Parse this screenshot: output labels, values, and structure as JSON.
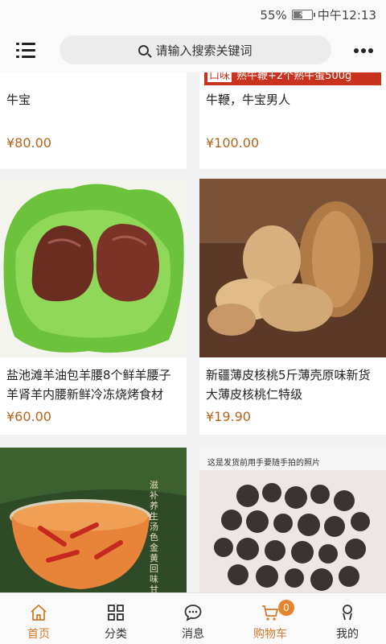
{
  "status_bar": {
    "battery": "55%",
    "time": "中午12:13",
    "battery_level": 0.55
  },
  "header": {
    "search_placeholder": "请输入搜索关键词"
  },
  "products": [
    {
      "title": "牛宝",
      "price": "¥80.00",
      "image": "partial-image"
    },
    {
      "title": "牛鞭，牛宝男人",
      "price": "¥100.00",
      "image": "banner-image",
      "banner_text": "口味 熟牛鞭+2个熟牛蛋500g",
      "banner_tag": "口味",
      "banner_body": "熟牛鞭+2个熟牛蛋500g"
    },
    {
      "title": "盐池滩羊油包羊腰8个鲜羊腰子羊肾羊内腰新鲜冷冻烧烤食材",
      "price": "¥60.00",
      "image": "lamb-kidney-photo"
    },
    {
      "title": "新疆薄皮核桃5斤薄壳原味新货大薄皮核桃仁特级",
      "price": "¥19.90",
      "image": "walnut-photo"
    },
    {
      "title": "",
      "price": "",
      "image": "goji-soup-photo",
      "image_text": "滋补养生 汤色金黄 回味甘甜"
    },
    {
      "title": "",
      "price": "",
      "image": "dried-berries-photo",
      "image_caption": "这是发货前用手要随手拍的照片"
    }
  ],
  "tabbar": {
    "tabs": [
      {
        "label": "首页",
        "icon": "home-icon",
        "active": true
      },
      {
        "label": "分类",
        "icon": "grid-icon",
        "active": false
      },
      {
        "label": "消息",
        "icon": "chat-icon",
        "active": false
      },
      {
        "label": "购物车",
        "icon": "cart-icon",
        "active": true,
        "badge": "0"
      },
      {
        "label": "我的",
        "icon": "user-icon",
        "active": false
      }
    ]
  },
  "colors": {
    "accent": "#d27a2a",
    "price": "#b3641c",
    "banner": "#c8321e"
  }
}
